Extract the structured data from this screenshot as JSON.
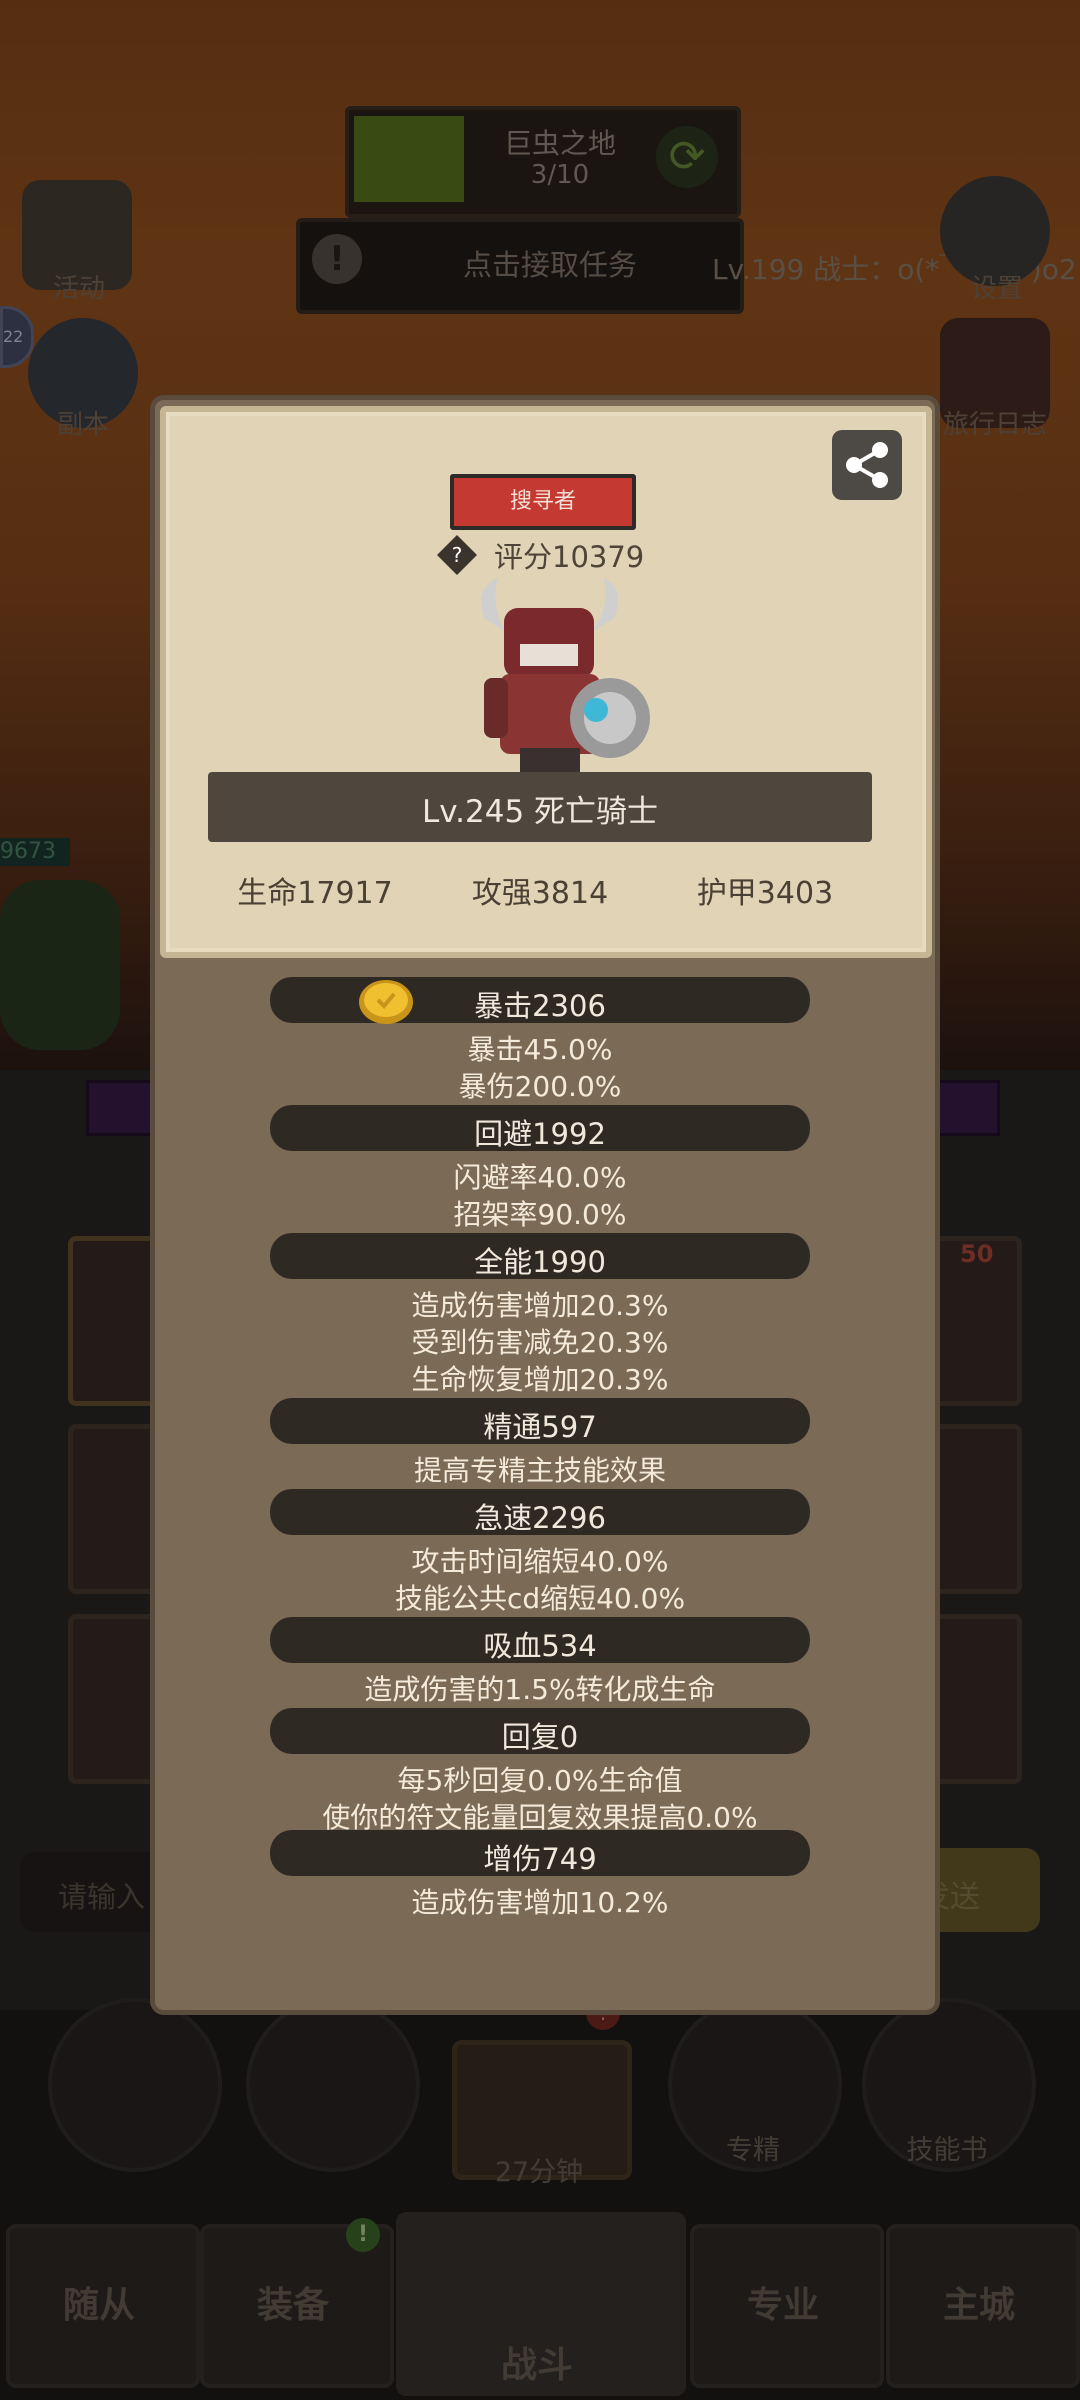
{
  "background": {
    "stage": {
      "name": "巨虫之地",
      "progress": "3/10"
    },
    "task": {
      "text": "点击接取任务",
      "icon": "!"
    },
    "player": {
      "text": "Lv.199 战士：o(*￣▽￣*)o2"
    },
    "side_left": [
      {
        "label": "活动"
      },
      {
        "label": "副本"
      }
    ],
    "side_right": [
      {
        "label": "设置"
      },
      {
        "label": "旅行日志"
      }
    ],
    "side_badge": "22",
    "hp_value": "9673",
    "slot_badge": "50",
    "chat": {
      "placeholder": "请输入",
      "send": "发送"
    },
    "actions": [
      {
        "label": ""
      },
      {
        "label": ""
      },
      {
        "label": "27分钟",
        "badge": "!"
      },
      {
        "label": "专精"
      },
      {
        "label": "技能书"
      }
    ],
    "nav": [
      {
        "label": "随从"
      },
      {
        "label": "装备",
        "badge": "!"
      },
      {
        "label": "战斗"
      },
      {
        "label": "专业"
      },
      {
        "label": "主城"
      }
    ]
  },
  "modal": {
    "class_badge": "搜寻者",
    "score": "评分10379",
    "name": "Lv.245 死亡骑士",
    "top_stats": [
      "生命17917",
      "攻强3814",
      "护甲3403"
    ],
    "stats": [
      {
        "header": "暴击2306",
        "lines": [
          "暴击45.0%",
          "暴伤200.0%"
        ]
      },
      {
        "header": "回避1992",
        "lines": [
          "闪避率40.0%",
          "招架率90.0%"
        ]
      },
      {
        "header": "全能1990",
        "lines": [
          "造成伤害增加20.3%",
          "受到伤害减免20.3%",
          "生命恢复增加20.3%"
        ]
      },
      {
        "header": "精通597",
        "lines": [
          "提高专精主技能效果"
        ]
      },
      {
        "header": "急速2296",
        "lines": [
          "攻击时间缩短40.0%",
          "技能公共cd缩短40.0%"
        ]
      },
      {
        "header": "吸血534",
        "lines": [
          "造成伤害的1.5%转化成生命"
        ]
      },
      {
        "header": "回复0",
        "lines": [
          "每5秒回复0.0%生命值",
          "使你的符文能量回复效果提高0.0%"
        ]
      },
      {
        "header": "增伤749",
        "lines": [
          "造成伤害增加10.2%"
        ]
      }
    ]
  },
  "colors": {
    "badge_red": "#c43a32",
    "card_bg": "#e1d4b6",
    "modal_bg": "#7b6a56",
    "stat_header_bg": "#2f2924"
  }
}
